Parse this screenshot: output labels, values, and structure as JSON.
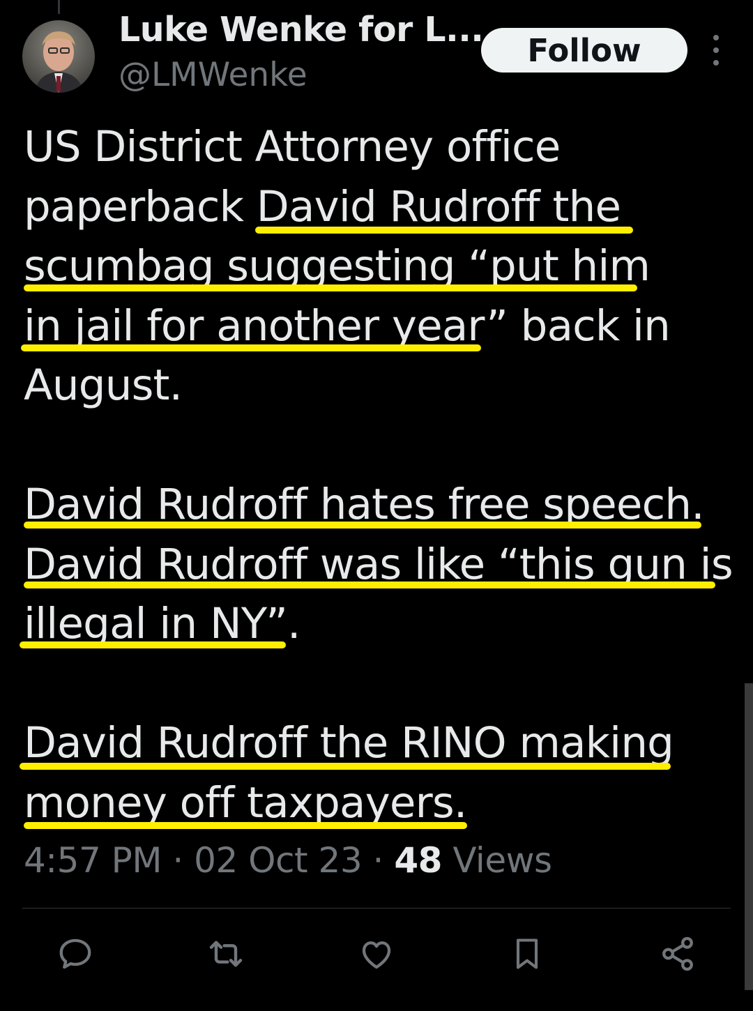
{
  "header": {
    "display_name": "Luke Wenke for L...",
    "handle": "@LMWenke",
    "follow_label": "Follow"
  },
  "tweet": {
    "lines": [
      "US District Attorney office",
      "paperback David Rudroff the",
      "scumbag suggesting “put him",
      "in jail for another year” back in",
      "August.",
      "",
      "David Rudroff hates free speech.",
      "David Rudroff was like “this gun is",
      "illegal in NY”.",
      "",
      "David Rudroff the RINO making",
      "money off taxpayers."
    ]
  },
  "meta": {
    "time": "4:57 PM",
    "separator": " · ",
    "date": "02 Oct 23",
    "views_count": "48",
    "views_label": " Views"
  },
  "actions": {
    "icons": [
      "reply-icon",
      "retweet-icon",
      "like-icon",
      "bookmark-icon",
      "share-icon"
    ]
  },
  "colors": {
    "background": "#000000",
    "text": "#e7e9ea",
    "secondary": "#71767b",
    "highlight": "#ffee00",
    "follow_bg": "#eff3f4"
  }
}
